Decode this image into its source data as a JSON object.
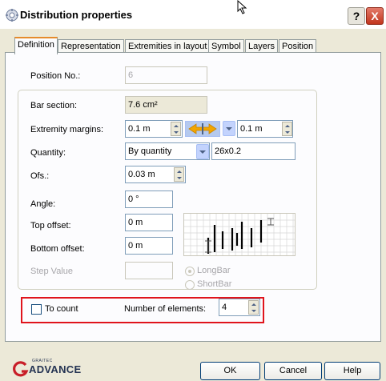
{
  "window": {
    "title": "Distribution properties",
    "help_label": "?",
    "close_label": "X"
  },
  "tabs": [
    {
      "label": "Definition",
      "active": true
    },
    {
      "label": "Representation",
      "active": false
    },
    {
      "label": "Extremities in layout",
      "active": false
    },
    {
      "label": "Symbol",
      "active": false
    },
    {
      "label": "Layers",
      "active": false
    },
    {
      "label": "Position",
      "active": false
    }
  ],
  "form": {
    "position_no": {
      "label": "Position No.:",
      "value": "6"
    },
    "bar_section": {
      "label": "Bar section:",
      "value": "7.6 cm²"
    },
    "extremity_margins": {
      "label": "Extremity margins:",
      "value_left": "0.1 m",
      "value_right": "0.1 m"
    },
    "quantity": {
      "label": "Quantity:",
      "selected": "By quantity",
      "value": "26x0.2"
    },
    "ofs": {
      "label": "Ofs.:",
      "value": "0.03 m"
    },
    "angle": {
      "label": "Angle:",
      "value": "0 °"
    },
    "top_offset": {
      "label": "Top offset:",
      "value": "0 m"
    },
    "bottom_offset": {
      "label": "Bottom offset:",
      "value": "0 m"
    },
    "step_value": {
      "label": "Step Value",
      "value": ""
    },
    "bar_options": {
      "longbar": "LongBar",
      "shortbar": "ShortBar",
      "selected": "LongBar"
    },
    "to_count": {
      "label": "To count",
      "checked": false
    },
    "number_of_elements": {
      "label": "Number of elements:",
      "value": "4"
    }
  },
  "footer": {
    "logo_small": "GRAITEC",
    "logo": "ADVANCE",
    "ok_label": "OK",
    "cancel_label": "Cancel",
    "help_label": "Help"
  },
  "colors": {
    "highlight": "#e0141c",
    "accent": "#e68b2c",
    "arrow": "#f2a500"
  }
}
